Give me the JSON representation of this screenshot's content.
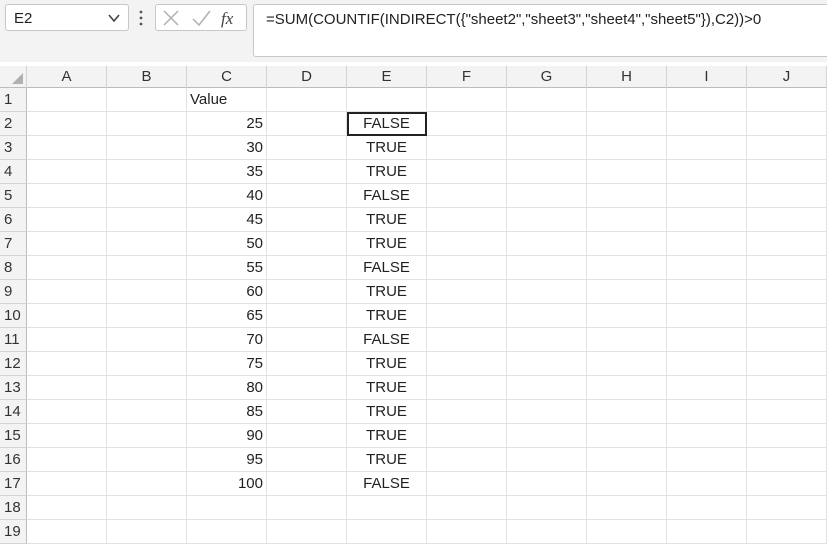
{
  "name_box": {
    "value": "E2"
  },
  "formula_bar": {
    "formula": "=SUM(COUNTIF(INDIRECT({\"sheet2\",\"sheet3\",\"sheet4\",\"sheet5\"}),C2))>0"
  },
  "columns": [
    "A",
    "B",
    "C",
    "D",
    "E",
    "F",
    "G",
    "H",
    "I",
    "J"
  ],
  "rows": [
    "1",
    "2",
    "3",
    "4",
    "5",
    "6",
    "7",
    "8",
    "9",
    "10",
    "11",
    "12",
    "13",
    "14",
    "15",
    "16",
    "17",
    "18",
    "19"
  ],
  "cells": {
    "C1": "Value",
    "C2": "25",
    "C3": "30",
    "C4": "35",
    "C5": "40",
    "C6": "45",
    "C7": "50",
    "C8": "55",
    "C9": "60",
    "C10": "65",
    "C11": "70",
    "C12": "75",
    "C13": "80",
    "C14": "85",
    "C15": "90",
    "C16": "95",
    "C17": "100",
    "E2": "FALSE",
    "E3": "TRUE",
    "E4": "TRUE",
    "E5": "FALSE",
    "E6": "TRUE",
    "E7": "TRUE",
    "E8": "FALSE",
    "E9": "TRUE",
    "E10": "TRUE",
    "E11": "FALSE",
    "E12": "TRUE",
    "E13": "TRUE",
    "E14": "TRUE",
    "E15": "TRUE",
    "E16": "TRUE",
    "E17": "FALSE"
  },
  "selected_cell": "E2"
}
